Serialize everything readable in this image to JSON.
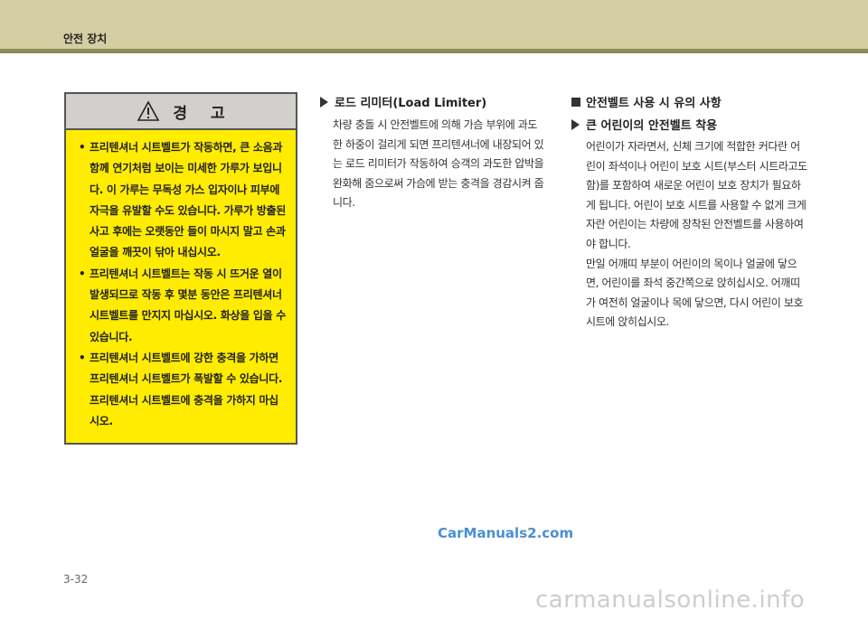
{
  "header": {
    "title": "안전 장치"
  },
  "warning": {
    "title_left": "경",
    "title_right": "고",
    "items": [
      "프리텐셔너 시트벨트가 작동하면, 큰 소음과 함께 연기처럼 보이는 미세한 가루가 보입니다. 이 가루는 무독성 가스 입자이나 피부에 자극을 유발할 수도 있습니다. 가루가 방출된 사고 후에는 오랫동안 들이 마시지 말고 손과 얼굴을 깨끗이 닦아 내십시오.",
      "프리텐셔너 시트벨트는 작동 시 뜨거운 열이 발생되므로 작동 후 몇분 동안은 프리텐셔너 시트벨트를 만지지 마십시오. 화상을 입을 수 있습니다.",
      "프리텐셔너 시트벨트에 강한 충격을 가하면 프리텐셔너 시트벨트가 폭발할 수 있습니다. 프리텐셔너 시트벨트에 충격을 가하지 마십시오."
    ]
  },
  "load_limiter": {
    "heading": "로드 리미터(Load Limiter)",
    "body": "차량 충돌 시 안전벨트에 의해 가슴 부위에 과도한 하중이 걸리게 되면 프리텐셔너에 내장되어 있는 로드 리미터가 작동하여 승객의 과도한 압박을 완화해 줌으로써 가슴에 받는 충격을 경감시켜 줍니다."
  },
  "precautions": {
    "heading": "안전벨트 사용 시 유의 사항",
    "subheading": "큰 어린이의 안전벨트 착용",
    "body1": "어린이가 자라면서, 신체 크기에 적합한 커다란 어린이 좌석이나 어린이 보호 시트(부스터 시트라고도 함)를 포함하여 새로운 어린이 보호 장치가 필요하게 됩니다. 어린이 보호 시트를 사용할 수 없게 크게 자란 어린이는 차량에 장착된 안전벨트를 사용하여야 합니다.",
    "body2": "만일 어깨띠 부분이 어린이의 목이나 얼굴에 닿으면, 어린이를 좌석 중간쪽으로 앉히십시오. 어깨띠가 여전히 얼굴이나 목에 닿으면, 다시 어린이 보호 시트에 앉히십시오."
  },
  "watermark": "CarManuals2.com",
  "page_number": "3-32",
  "footer_watermark": "carmanualsonline.info"
}
